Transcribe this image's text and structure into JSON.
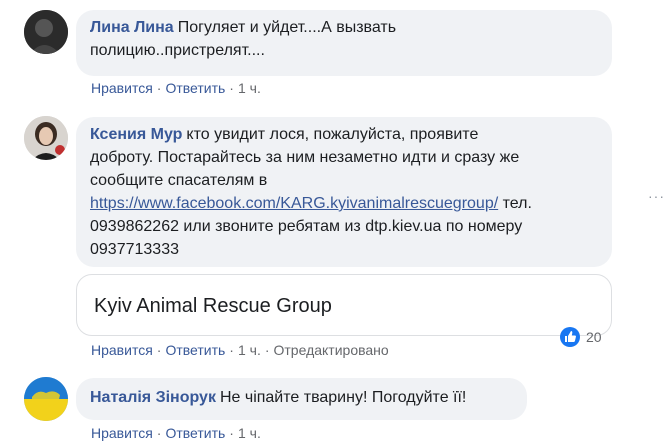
{
  "comments": [
    {
      "author": "Лина Лина",
      "lines": [
        "Погуляет и уйдет....А вызвать",
        "полицию..пристрелят...."
      ],
      "actions": {
        "like": "Нравится",
        "reply": "Ответить",
        "time": "1 ч."
      }
    },
    {
      "author": "Ксения Мур",
      "lines": [
        "кто увидит лося, пожалуйста, проявите",
        "доброту. Постарайтесь за ним незаметно идти и сразу же",
        "сообщите спасателям в"
      ],
      "link": "https://www.facebook.com/KARG.kyivanimalrescuegroup/",
      "after_link": " тел.",
      "lines2": [
        "0939862262 или звоните ребятам из dtp.kiev.ua по номеру",
        "0937713333"
      ],
      "preview_title": "Kyiv Animal Rescue Group",
      "reaction_count": "20",
      "actions": {
        "like": "Нравится",
        "reply": "Ответить",
        "time": "1 ч.",
        "edited": "Отредактировано"
      }
    },
    {
      "author": "Наталія Зінорук",
      "lines": [
        "Не чіпайте тварину! Погодуйте її!"
      ],
      "actions": {
        "like": "Нравится",
        "reply": "Ответить",
        "time": "1 ч."
      }
    }
  ],
  "colors": {
    "author": "#385898",
    "bubble": "#f0f2f5",
    "meta": "#65676b",
    "like": "#1877f2"
  },
  "icons": {
    "reaction": "like-icon",
    "more": "more-options-icon"
  }
}
